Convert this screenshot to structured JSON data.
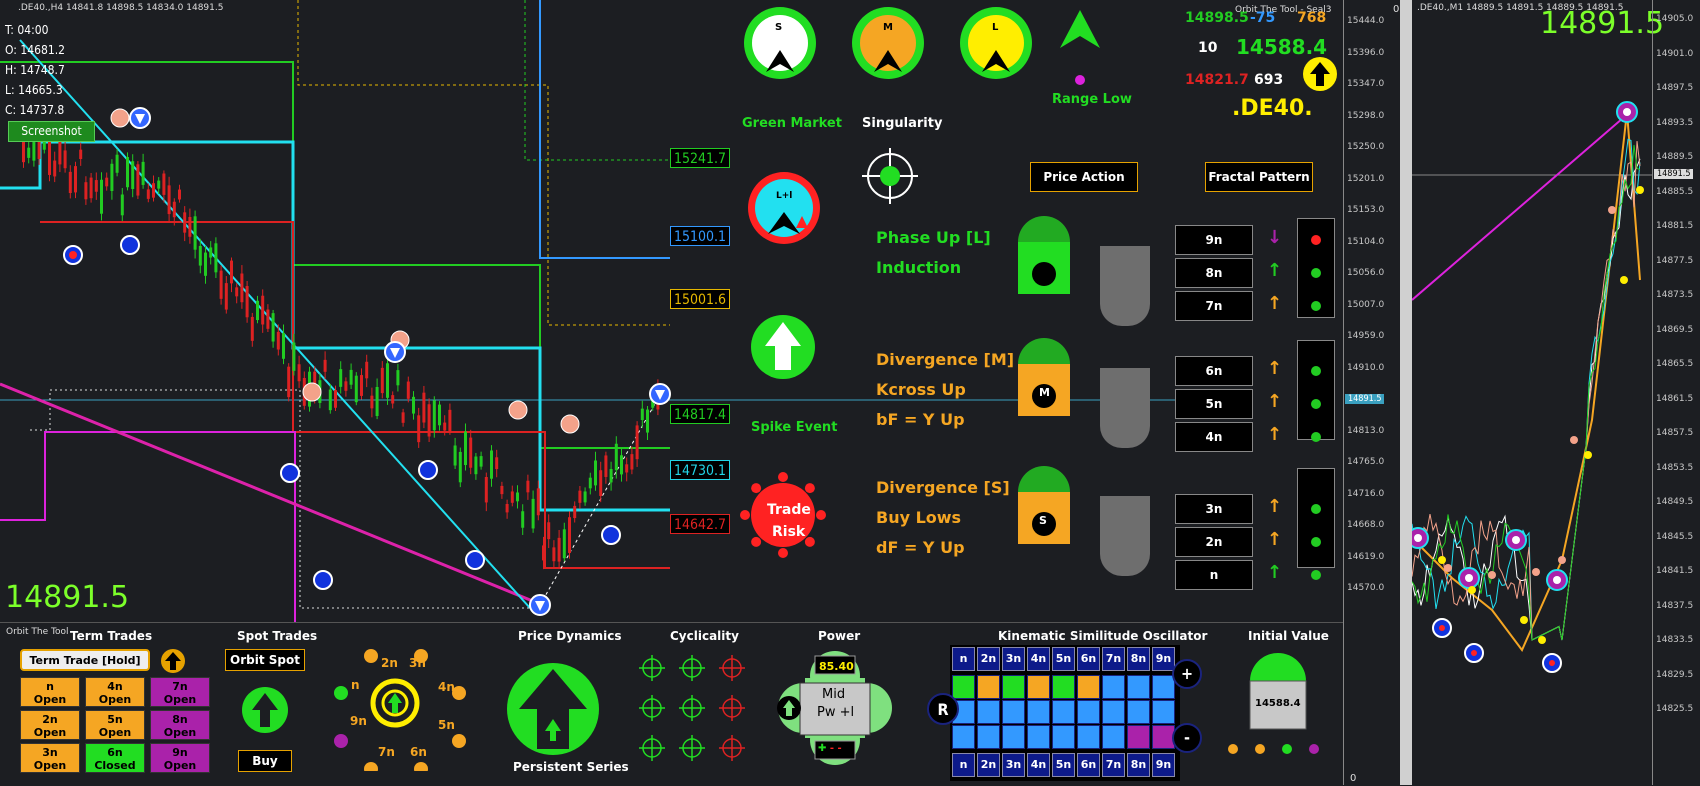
{
  "main_chart": {
    "header": ".DE40.,H4  14841.8 14898.5 14834.0 14891.5",
    "ohlc": [
      "T: 04:00",
      "O: 14681.2",
      "H: 14748.7",
      "L: 14665.3",
      "C: 14737.8"
    ],
    "screenshot_label": "Screenshot",
    "last_price": "14891.5",
    "level_labels": [
      {
        "text": "15241.7",
        "color": "#22cc22"
      },
      {
        "text": "15100.1",
        "color": "#3399ff"
      },
      {
        "text": "15001.6",
        "color": "#e6b800"
      },
      {
        "text": "14817.4",
        "color": "#22cc22"
      },
      {
        "text": "14730.1",
        "color": "#22d4e6"
      },
      {
        "text": "14642.7",
        "color": "#dd2222"
      }
    ],
    "axis_ticks": [
      "15444.0",
      "15396.0",
      "15347.0",
      "15298.0",
      "15250.0",
      "15201.0",
      "15153.0",
      "15104.0",
      "15056.0",
      "15007.0",
      "14959.0",
      "14910.0",
      "14862.0",
      "14813.0",
      "14765.0",
      "14716.0",
      "14668.0",
      "14619.0",
      "14570.0"
    ],
    "axis_current": "14891.5"
  },
  "dashboard": {
    "dial_letters": [
      "S",
      "M",
      "L"
    ],
    "range_low": "Range Low",
    "stats": {
      "top_left": "14898.5",
      "top_mid": "-75",
      "top_right": "768",
      "mid_left": "10",
      "mid_big": "14588.4",
      "low_left": "14821.7",
      "low_mid": "693",
      "symbol": ".DE40."
    },
    "brand": "Orbit The Tool - Seal3",
    "green_market": "Green Market",
    "singularity": "Singularity",
    "price_action": "Price Action",
    "fractal_pattern": "Fractal Pattern",
    "lpl_label": "L+l",
    "spike_event": "Spike Event",
    "trade_risk": [
      "Trade",
      "Risk"
    ],
    "phase_groups": [
      {
        "lines": [
          "Phase Up [L]",
          "Induction"
        ],
        "color": "#22dd22",
        "letter": "",
        "fill": "#22dd22"
      },
      {
        "lines": [
          "Divergence [M]",
          "Kcross Up",
          "bF = Y Up"
        ],
        "color": "#f5a623",
        "letter": "M",
        "fill": "#f5a623"
      },
      {
        "lines": [
          "Divergence [S]",
          "Buy Lows",
          "dF = Y Up"
        ],
        "color": "#f5a623",
        "letter": "S",
        "fill": "#f5a623"
      }
    ],
    "n_boxes": [
      "9n",
      "8n",
      "7n",
      "6n",
      "5n",
      "4n",
      "3n",
      "2n",
      "n"
    ],
    "n_arrows": [
      {
        "sym": "↓",
        "color": "#aa22aa"
      },
      {
        "sym": "↑",
        "color": "#22cc22"
      },
      {
        "sym": "↑",
        "color": "#f5a623"
      },
      {
        "sym": "↑",
        "color": "#f5a623"
      },
      {
        "sym": "↑",
        "color": "#f5a623"
      },
      {
        "sym": "↑",
        "color": "#f5a623"
      },
      {
        "sym": "↑",
        "color": "#f5a623"
      },
      {
        "sym": "↑",
        "color": "#f5a623"
      },
      {
        "sym": "↑",
        "color": "#22cc22"
      }
    ],
    "lights": [
      "#ff2222",
      "#22cc22",
      "#22cc22",
      "#22cc22",
      "#22cc22",
      "#22cc22",
      "#22cc22",
      "#22cc22",
      "#22cc22"
    ]
  },
  "bottom": {
    "brand": "Orbit The Tool",
    "term_trades": "Term Trades",
    "term_button": "Term Trade [Hold]",
    "term_cells": [
      {
        "n": "n",
        "s": "Open",
        "c": "#f5a623"
      },
      {
        "n": "4n",
        "s": "Open",
        "c": "#f5a623"
      },
      {
        "n": "7n",
        "s": "Open",
        "c": "#aa22aa"
      },
      {
        "n": "2n",
        "s": "Open",
        "c": "#f5a623"
      },
      {
        "n": "5n",
        "s": "Open",
        "c": "#f5a623"
      },
      {
        "n": "8n",
        "s": "Open",
        "c": "#aa22aa"
      },
      {
        "n": "3n",
        "s": "Open",
        "c": "#f5a623"
      },
      {
        "n": "6n",
        "s": "Closed",
        "c": "#22dd22"
      },
      {
        "n": "9n",
        "s": "Open",
        "c": "#aa22aa"
      }
    ],
    "spot_trades": "Spot Trades",
    "orbit_spot": "Orbit Spot",
    "buy": "Buy",
    "orbit_labels": [
      "2n",
      "3n",
      "n",
      "4n",
      "9n",
      "5n",
      "7n",
      "6n"
    ],
    "price_dynamics": "Price Dynamics",
    "persistent_series": "Persistent Series",
    "cyclicality": "Cyclicality",
    "power": "Power",
    "power_value": "85.40",
    "power_text": [
      "Mid",
      "Pw +l"
    ],
    "kso_title": "Kinematic Similitude Oscillator",
    "kso_header": [
      "n",
      "2n",
      "3n",
      "4n",
      "5n",
      "6n",
      "7n",
      "8n",
      "9n"
    ],
    "kso_rows": [
      [
        "#22dd22",
        "#f5a623",
        "#22dd22",
        "#f5a623",
        "#22dd22",
        "#f5a623",
        "#3399ff",
        "#3399ff",
        "#3399ff"
      ],
      [
        "#3399ff",
        "#3399ff",
        "#3399ff",
        "#3399ff",
        "#3399ff",
        "#3399ff",
        "#3399ff",
        "#3399ff",
        "#3399ff"
      ],
      [
        "#3399ff",
        "#3399ff",
        "#3399ff",
        "#3399ff",
        "#3399ff",
        "#3399ff",
        "#3399ff",
        "#aa22aa",
        "#aa22aa"
      ]
    ],
    "kso_r": "R",
    "kso_plus": "+",
    "kso_minus": "-",
    "initial_value": "Initial Value",
    "initial_number": "14588.4"
  },
  "side_chart": {
    "header": ".DE40.,M1  14889.5 14891.5 14889.5 14891.5",
    "last_price": "14891.5",
    "axis_ticks": [
      "14905.0",
      "14901.0",
      "14897.5",
      "14893.5",
      "14889.5",
      "14885.5",
      "14881.5",
      "14877.5",
      "14873.5",
      "14869.5",
      "14865.5",
      "14861.5",
      "14857.5",
      "14853.5",
      "14849.5",
      "14845.5",
      "14841.5",
      "14837.5",
      "14833.5",
      "14829.5",
      "14825.5"
    ],
    "axis_current": "14891.5"
  }
}
